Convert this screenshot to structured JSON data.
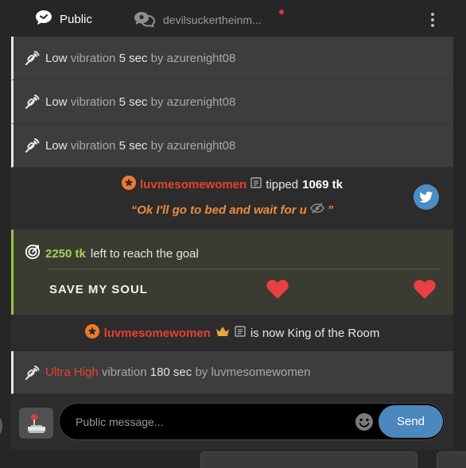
{
  "tabs": {
    "public_label": "Public",
    "pm_label": "devilsuckertheinm..."
  },
  "vibration_rows": [
    {
      "level": "Low",
      "word": "vibration",
      "duration": "5 sec",
      "by": "by",
      "user": "azurenight08"
    },
    {
      "level": "Low",
      "word": "vibration",
      "duration": "5 sec",
      "by": "by",
      "user": "azurenight08"
    },
    {
      "level": "Low",
      "word": "vibration",
      "duration": "5 sec",
      "by": "by",
      "user": "azurenight08"
    }
  ],
  "tip": {
    "user": "luvmesomewomen",
    "action": "tipped",
    "amount": "1069 tk",
    "message": "“Ok I'll go to bed and wait for u",
    "message_end": "”"
  },
  "goal": {
    "amount": "2250 tk",
    "text": "left to reach the goal",
    "title": "SAVE MY SOUL"
  },
  "king": {
    "user": "luvmesomewomen",
    "text": "is now King of the Room"
  },
  "last_vibration": {
    "level": "Ultra High",
    "word": "vibration",
    "duration": "180 sec",
    "by": "by",
    "user": "luvmesomewomen"
  },
  "composer": {
    "placeholder": "Public message...",
    "send_label": "Send"
  },
  "colors": {
    "accent_red": "#d2332e",
    "goal_green": "#9bc43e",
    "send_blue": "#4c87bd",
    "username_red": "#e8412e",
    "quote_orange": "#f08a3c"
  }
}
